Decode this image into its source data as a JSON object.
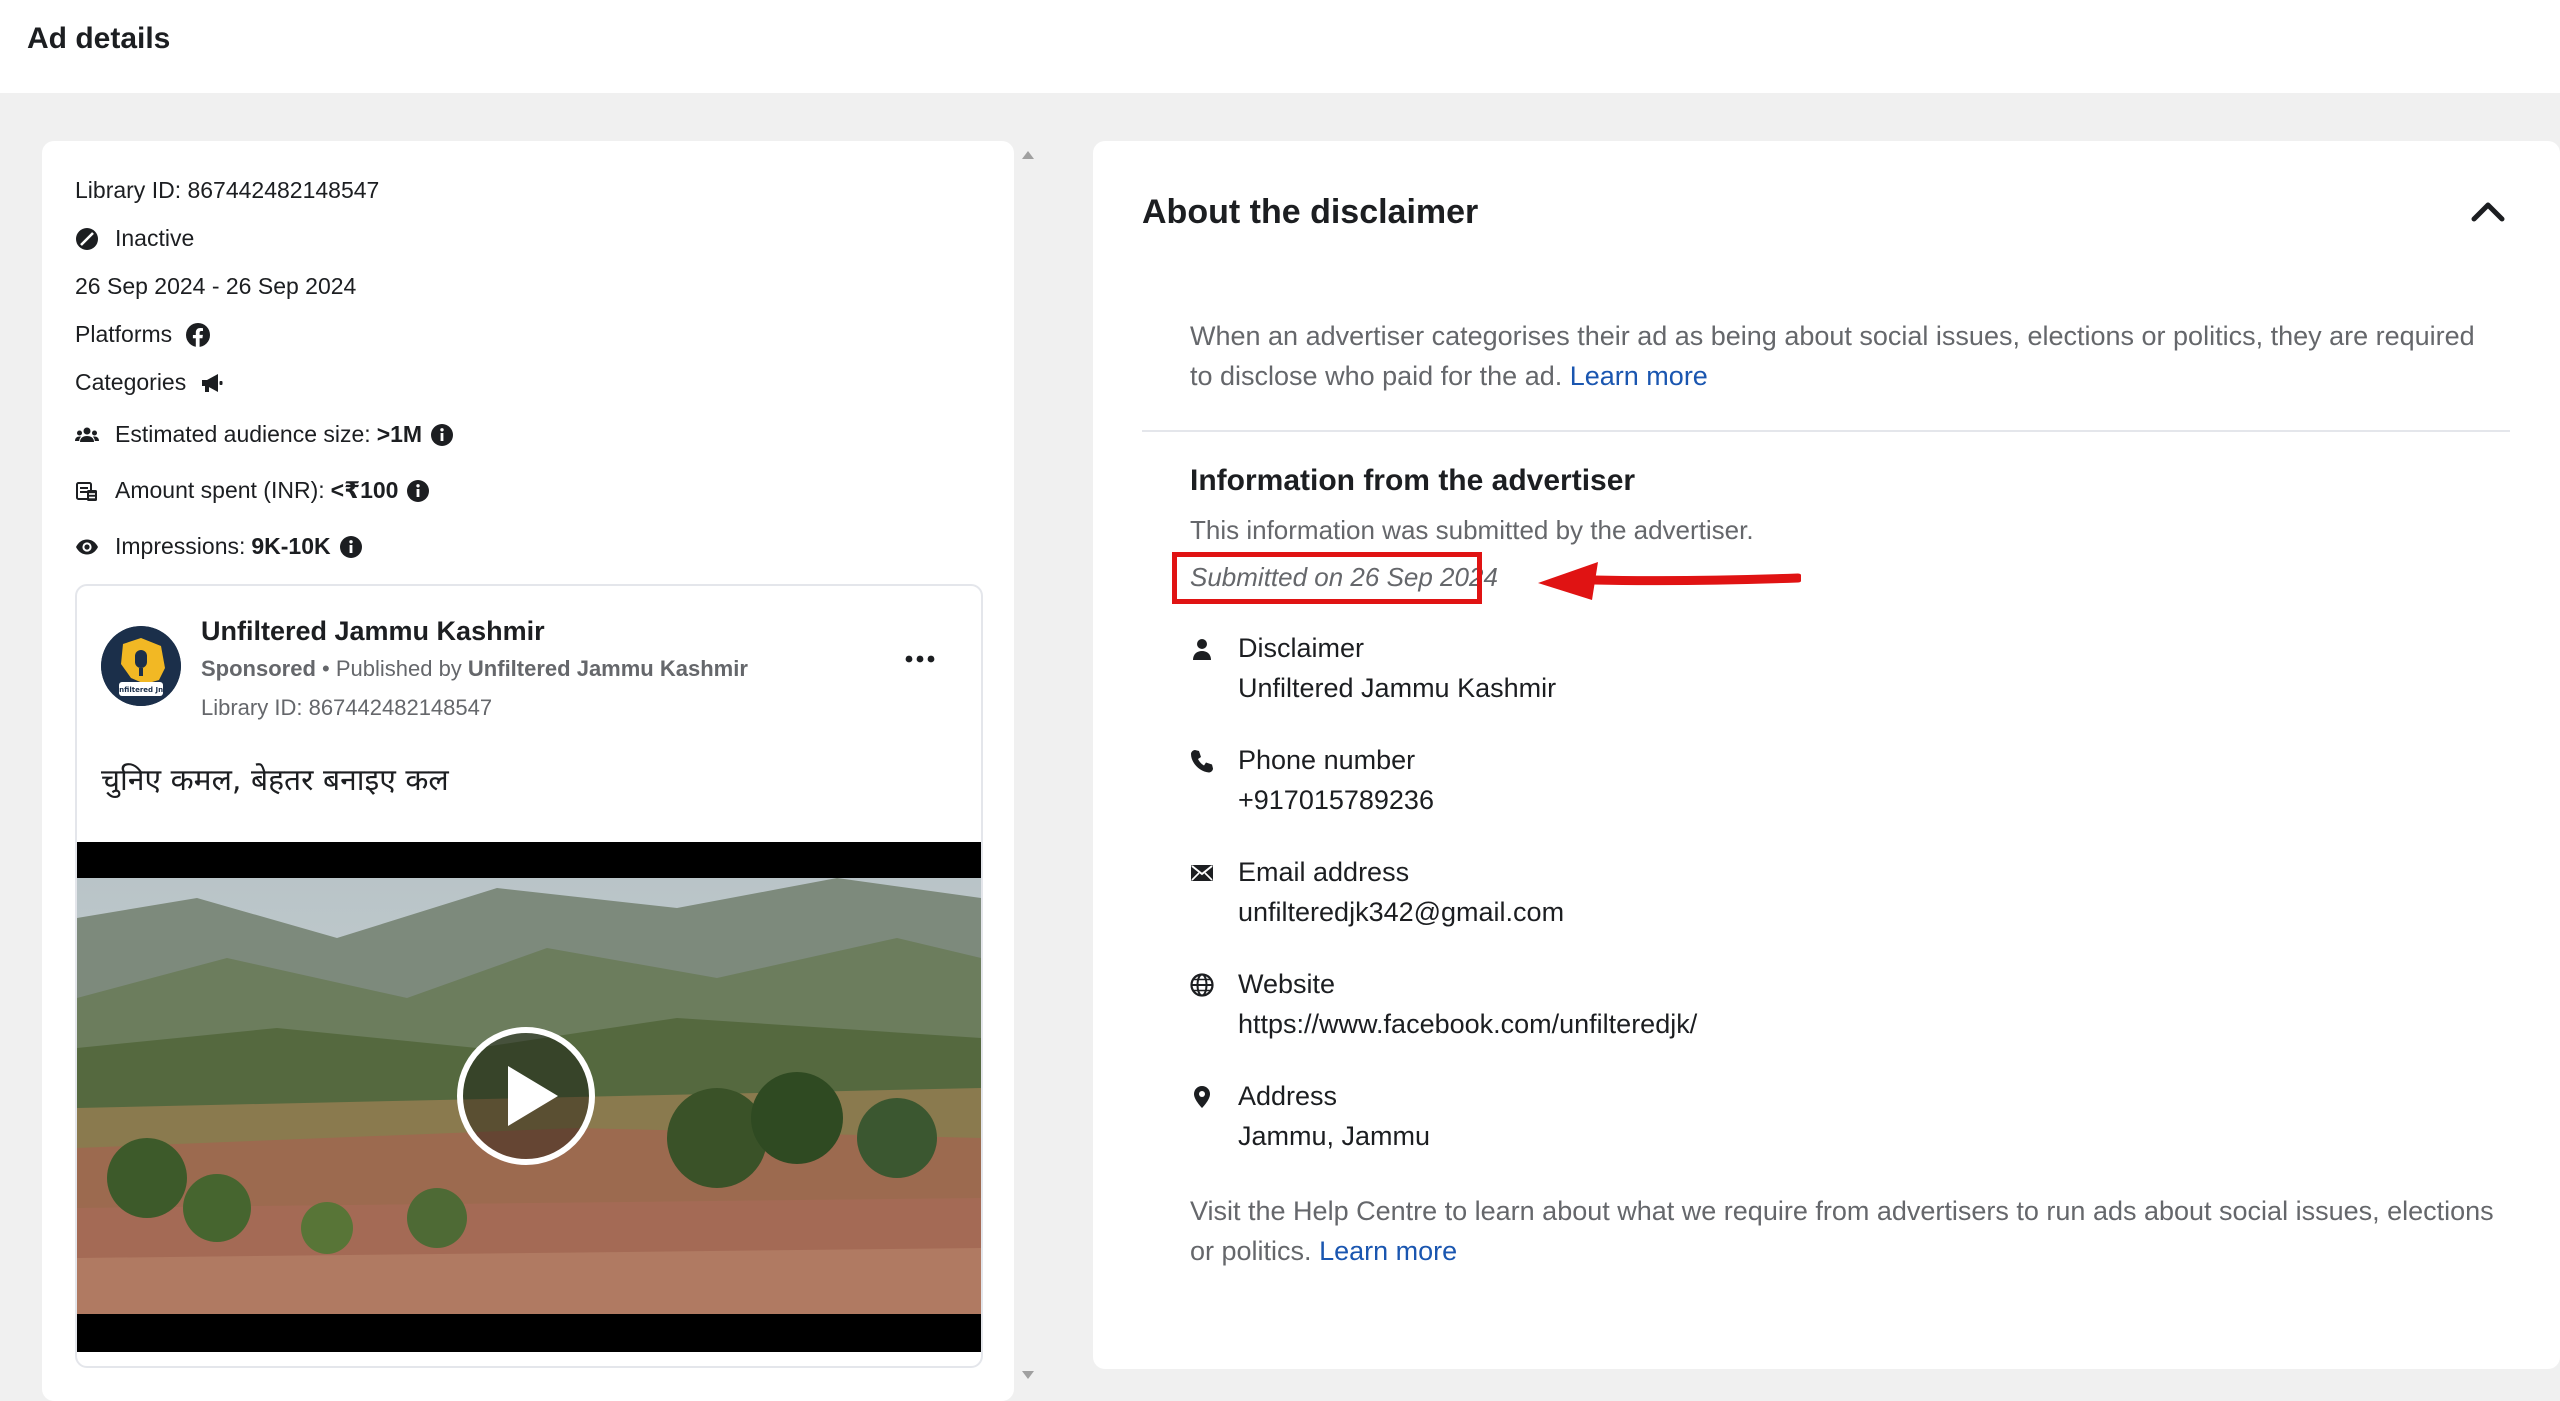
{
  "header": {
    "title": "Ad details"
  },
  "ad_meta": {
    "library_id": "Library ID: 867442482148547",
    "status": "Inactive",
    "date_range": "26 Sep 2024 - 26 Sep 2024",
    "platforms_label": "Platforms",
    "categories_label": "Categories",
    "audience_label": "Estimated audience size:",
    "audience_value": ">1M",
    "amount_label": "Amount spent (INR):",
    "amount_value": "<₹100",
    "impressions_label": "Impressions:",
    "impressions_value": "9K-10K"
  },
  "ad_preview": {
    "page_name": "Unfiltered Jammu Kashmir",
    "sponsored": "Sponsored",
    "published_by_prefix": " • Published by ",
    "publisher": "Unfiltered Jammu Kashmir",
    "library_id": "Library ID: 867442482148547",
    "body_text": "चुनिए कमल, बेहतर बनाइए कल",
    "avatar_text": "Unfiltered JnK"
  },
  "disclaimer": {
    "title": "About the disclaimer",
    "description": "When an advertiser categorises their ad as being about social issues, elections or politics, they are required to disclose who paid for the ad.",
    "learn_more": "Learn more",
    "info_heading": "Information from the advertiser",
    "info_sub": "This information was submitted by the advertiser.",
    "submitted_on": "Submitted on 26 Sep 2024",
    "contacts": [
      {
        "label": "Disclaimer",
        "value": "Unfiltered Jammu Kashmir",
        "icon": "person-icon"
      },
      {
        "label": "Phone number",
        "value": "+917015789236",
        "icon": "phone-icon"
      },
      {
        "label": "Email address",
        "value": "unfilteredjk342@gmail.com",
        "icon": "email-icon"
      },
      {
        "label": "Website",
        "value": "https://www.facebook.com/unfilteredjk/",
        "icon": "globe-icon"
      },
      {
        "label": "Address",
        "value": "Jammu, Jammu",
        "icon": "location-pin-icon"
      }
    ],
    "help_text": "Visit the Help Centre to learn about what we require from advertisers to run ads about social issues, elections or politics.",
    "help_learn_more": "Learn more"
  },
  "colors": {
    "link": "#1a56b0",
    "annotation_red": "#e01313",
    "secondary_text": "#65676b",
    "page_background": "#f0f0f0"
  }
}
